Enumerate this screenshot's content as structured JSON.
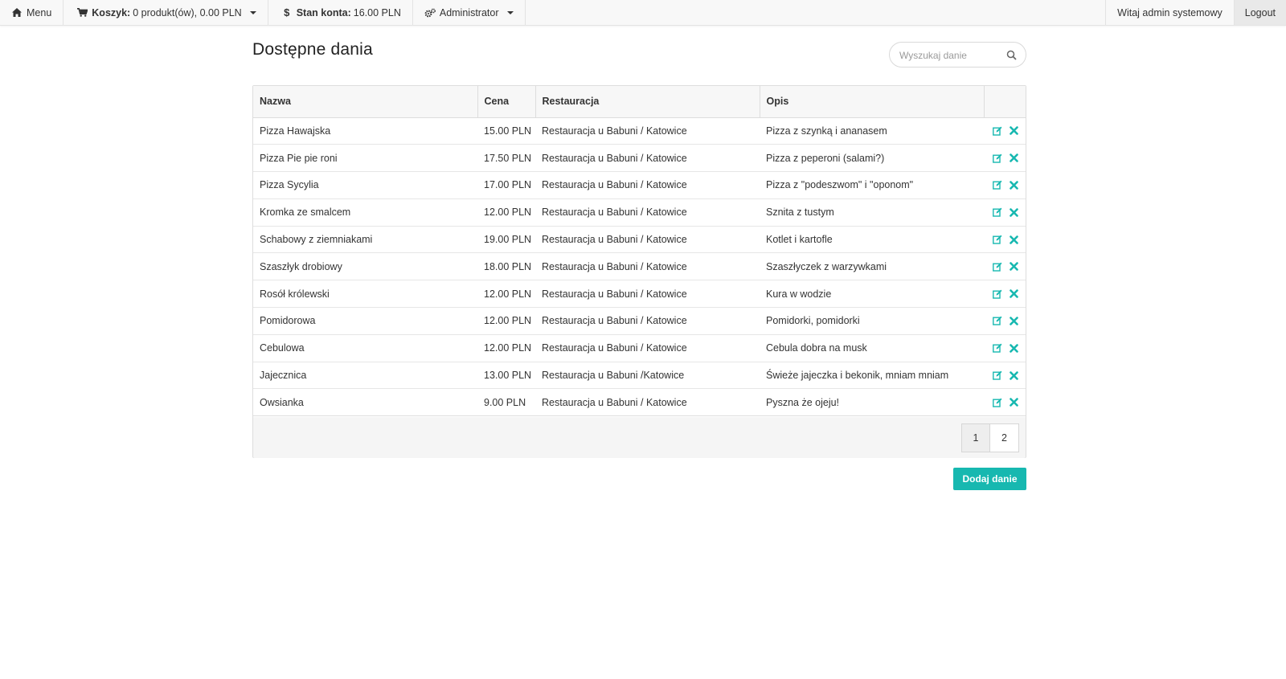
{
  "navbar": {
    "menu_label": "Menu",
    "cart_label": "Koszyk:",
    "cart_value": "0 produkt(ów), 0.00 PLN",
    "balance_label": "Stan konta:",
    "balance_value": "16.00 PLN",
    "admin_label": "Administrator",
    "welcome_text": "Witaj admin systemowy",
    "logout_label": "Logout",
    "icons": {
      "menu": "home-icon",
      "cart": "shopping-cart-icon",
      "balance": "dollar-icon",
      "admin": "gears-icon"
    }
  },
  "main": {
    "title": "Dostępne dania",
    "search_placeholder": "Wyszukaj danie",
    "table": {
      "columns": [
        "Nazwa",
        "Cena",
        "Restauracja",
        "Opis",
        ""
      ],
      "rows": [
        [
          "Pizza Hawajska",
          "15.00 PLN",
          "Restauracja u Babuni / Katowice",
          "Pizza z szynką i ananasem"
        ],
        [
          "Pizza Pie pie roni",
          "17.50 PLN",
          "Restauracja u Babuni / Katowice",
          "Pizza z peperoni (salami?)"
        ],
        [
          "Pizza Sycylia",
          "17.00 PLN",
          "Restauracja u Babuni / Katowice",
          "Pizza z \"podeszwom\" i \"oponom\""
        ],
        [
          "Kromka ze smalcem",
          "12.00 PLN",
          "Restauracja u Babuni / Katowice",
          "Sznita z tustym"
        ],
        [
          "Schabowy z ziemniakami",
          "19.00 PLN",
          "Restauracja u Babuni / Katowice",
          "Kotlet i kartofle"
        ],
        [
          "Szaszłyk drobiowy",
          "18.00 PLN",
          "Restauracja u Babuni / Katowice",
          "Szaszłyczek z warzywkami"
        ],
        [
          "Rosół królewski",
          "12.00 PLN",
          "Restauracja u Babuni / Katowice",
          "Kura w wodzie"
        ],
        [
          "Pomidorowa",
          "12.00 PLN",
          "Restauracja u Babuni / Katowice",
          "Pomidorki, pomidorki"
        ],
        [
          "Cebulowa",
          "12.00 PLN",
          "Restauracja u Babuni / Katowice",
          "Cebula dobra na musk"
        ],
        [
          "Jajecznica",
          "13.00 PLN",
          "Restauracja u Babuni /Katowice",
          "Świeże jajeczka i bekonik, mniam mniam"
        ],
        [
          "Owsianka",
          "9.00 PLN",
          "Restauracja u Babuni / Katowice",
          "Pyszna że ojeju!"
        ]
      ],
      "row_actions": [
        "edit-icon",
        "delete-icon"
      ]
    },
    "pagination": [
      "1",
      "2"
    ],
    "current_page": "1",
    "add_button_label": "Dodaj danie"
  },
  "colors": {
    "accent": "#17b8b0",
    "navbar_bg": "#f8f8f8",
    "table_header_bg": "#f7f7f7"
  }
}
